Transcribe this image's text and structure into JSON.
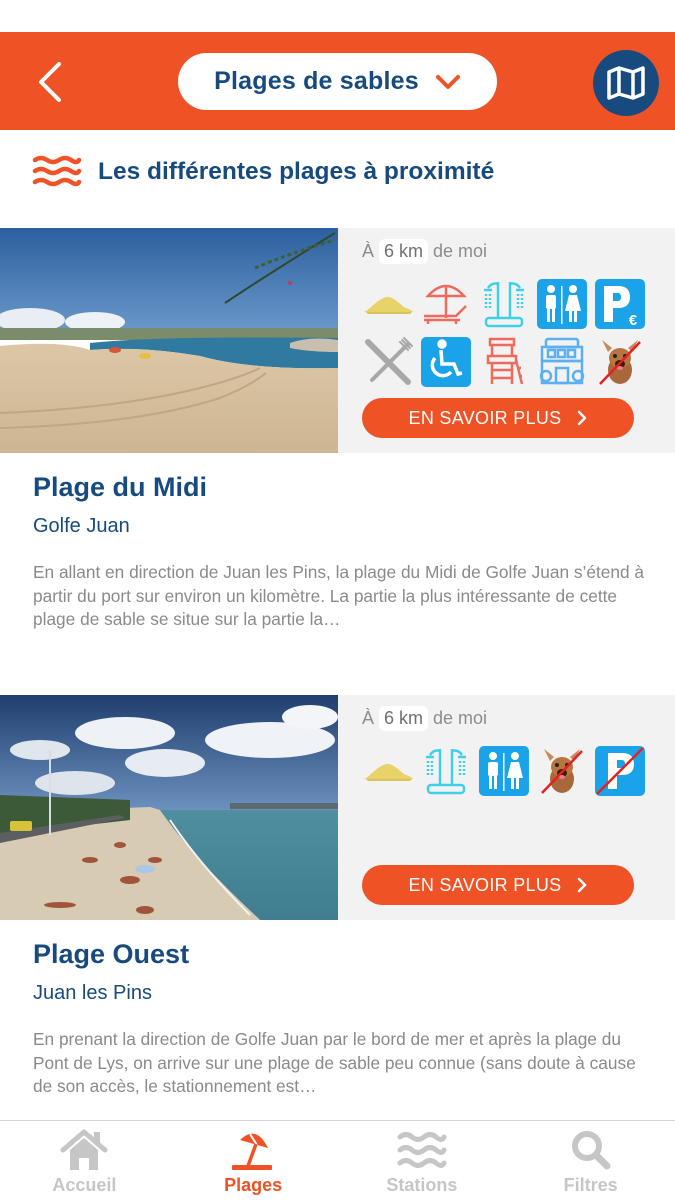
{
  "header": {
    "back_icon": "chevron-left-icon",
    "title": "Plages de sables",
    "dropdown_icon": "chevron-down-icon",
    "map_icon": "map-icon"
  },
  "section": {
    "icon": "waves-icon",
    "title": "Les différentes plages à proximité"
  },
  "beaches": [
    {
      "distance_prefix": "À",
      "distance_value": "6 km",
      "distance_suffix": "de moi",
      "amenities": [
        "sand-icon",
        "sunbed-umbrella-icon",
        "shower-icon",
        "toilets-icon",
        "paid-parking-icon",
        "restaurant-icon",
        "wheelchair-access-icon",
        "lifeguard-tower-icon",
        "shop-icon",
        "no-dogs-icon"
      ],
      "button_label": "EN SAVOIR PLUS",
      "name": "Plage du Midi",
      "town": "Golfe Juan",
      "description": "En allant en direction de Juan les Pins, la plage du Midi de Golfe Juan s’étend à partir du port sur environ un kilomètre. La partie la plus intéressante de cette plage de sable se situe sur la partie la…"
    },
    {
      "distance_prefix": "À",
      "distance_value": "6 km",
      "distance_suffix": "de moi",
      "amenities": [
        "sand-icon",
        "shower-icon",
        "toilets-icon",
        "no-dogs-icon",
        "no-parking-icon"
      ],
      "button_label": "EN SAVOIR PLUS",
      "name": "Plage Ouest",
      "town": "Juan les Pins",
      "description": "En prenant la direction de Golfe Juan par le bord de mer et après la plage du Pont de Lys, on arrive sur une plage de sable peu connue (sans doute à cause de son accès, le stationnement est…"
    }
  ],
  "tabbar": {
    "tabs": [
      {
        "label": "Accueil",
        "icon": "home-icon",
        "active": false
      },
      {
        "label": "Plages",
        "icon": "beach-umbrella-icon",
        "active": true
      },
      {
        "label": "Stations",
        "icon": "waves-icon",
        "active": false
      },
      {
        "label": "Filtres",
        "icon": "search-icon",
        "active": false
      }
    ]
  },
  "colors": {
    "brand_orange": "#ef5225",
    "brand_blue": "#174a7e",
    "panel_grey": "#f2f2f2",
    "tab_inactive": "#c6c6c6"
  }
}
